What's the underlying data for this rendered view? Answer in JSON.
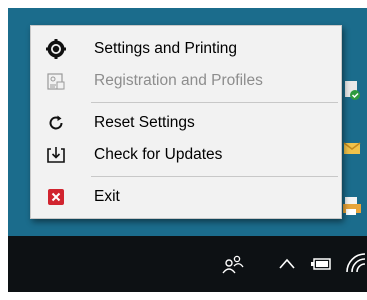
{
  "menu": {
    "items": [
      {
        "label": "Settings and Printing",
        "icon": "gear-icon",
        "enabled": true
      },
      {
        "label": "Registration and Profiles",
        "icon": "registration-profile-icon",
        "enabled": false
      },
      {
        "label": "Reset Settings",
        "icon": "reset-arrow-icon",
        "enabled": true
      },
      {
        "label": "Check for Updates",
        "icon": "download-update-icon",
        "enabled": true
      },
      {
        "label": "Exit",
        "icon": "exit-x-icon",
        "enabled": true
      }
    ]
  },
  "taskbar": {
    "tray_icons": [
      "people-icon",
      "chevron-up-icon",
      "battery-icon",
      "wifi-icon"
    ]
  },
  "colors": {
    "desktop": "#1b6c8c",
    "taskbar": "#0d1114",
    "menu_bg": "#f2f2f2",
    "disabled_text": "#8d8d8d",
    "exit_red": "#d1242f"
  }
}
